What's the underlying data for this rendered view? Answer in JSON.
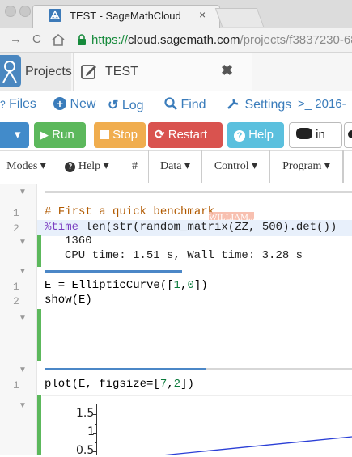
{
  "browser": {
    "tab_title": "TEST - SageMathCloud",
    "url_proto": "https://",
    "url_host": "cloud.sagemath.com",
    "url_path": "/projects/f3837230-68",
    "tab_close": "×"
  },
  "sage": {
    "projects_label": "Projects",
    "open_tab_label": "TEST",
    "close_glyph": "✖"
  },
  "actions": {
    "files": "Files",
    "new": "New",
    "log": "Log",
    "find": "Find",
    "settings": "Settings",
    "terminal": ">_ 2016-"
  },
  "buttons": {
    "run": "Run",
    "stop": "Stop",
    "restart": "Restart",
    "help": "Help",
    "in": "in"
  },
  "colors": {
    "run": "#5cb85c",
    "stop": "#f0ad4e",
    "restart": "#d9534f",
    "help": "#5bc0de",
    "primary": "#428bca"
  },
  "menus": {
    "modes": "Modes ▾",
    "help": "Help ▾",
    "hash": "#",
    "data": "Data ▾",
    "control": "Control ▾",
    "program": "Program ▾"
  },
  "cell1": {
    "line1_num": "1",
    "line2_num": "2",
    "comment": "# First a quick benchmark",
    "code_magic": "%time",
    "code_rest": " len(str(random_matrix(ZZ, 500).det())",
    "tooltip": "WILLIAM...",
    "out_value": "1360",
    "out_time": "CPU time: 1.51 s, Wall time: 3.28 s"
  },
  "cell2": {
    "line1_num": "1",
    "line2_num": "2",
    "line1_a": "E = EllipticCurve([",
    "line1_n1": "1",
    "line1_c": ",",
    "line1_n2": "0",
    "line1_b": "])",
    "line2": "show(E)"
  },
  "cell3": {
    "line1_num": "1",
    "line1_a": "plot(E, figsize=[",
    "line1_n1": "7",
    "line1_c": ",",
    "line1_n2": "2",
    "line1_b": "])"
  },
  "plot": {
    "ticks": [
      "1.5",
      "1",
      "0.5"
    ]
  }
}
